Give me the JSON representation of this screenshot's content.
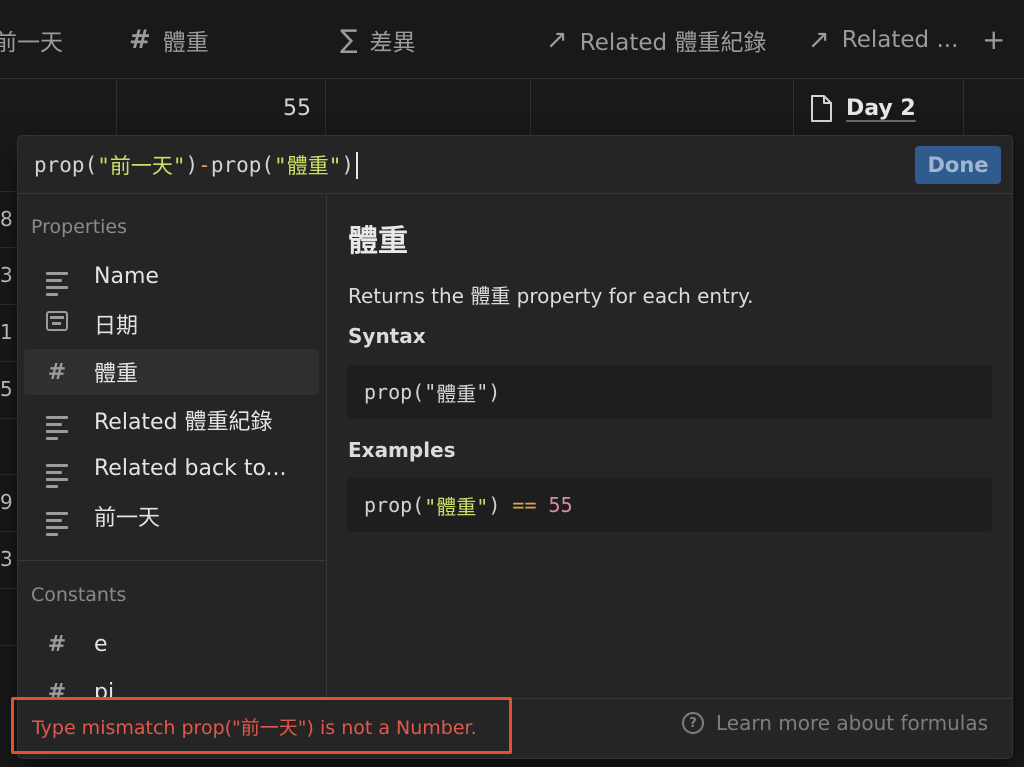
{
  "table": {
    "columns": [
      {
        "icon": "",
        "label": "前一天"
      },
      {
        "icon": "number-icon",
        "label": "體重"
      },
      {
        "icon": "sigma-icon",
        "label": "差異"
      },
      {
        "icon": "arrow-up-right-icon",
        "label": "Related 體重紀錄"
      },
      {
        "icon": "arrow-up-right-icon",
        "label": "Related ..."
      }
    ],
    "add_column": "+",
    "row": {
      "weight": "55",
      "page_title": "Day 2"
    },
    "peek_values": [
      "8",
      "3",
      "1",
      "5",
      "9",
      "3"
    ]
  },
  "editor": {
    "formula_parts": [
      "prop(",
      "\"前一天\"",
      ")",
      "-",
      "prop(",
      "\"體重\"",
      ")"
    ],
    "done_label": "Done"
  },
  "sidebar": {
    "properties_title": "Properties",
    "properties": [
      {
        "icon": "text-lines-icon",
        "label": "Name"
      },
      {
        "icon": "calendar-icon",
        "label": "日期"
      },
      {
        "icon": "number-icon",
        "label": "體重",
        "selected": true
      },
      {
        "icon": "text-lines-icon",
        "label": "Related 體重紀錄"
      },
      {
        "icon": "text-lines-icon",
        "label": "Related back to..."
      },
      {
        "icon": "text-lines-icon",
        "label": "前一天"
      }
    ],
    "constants_title": "Constants",
    "constants": [
      {
        "icon": "number-icon",
        "label": "e"
      },
      {
        "icon": "number-icon",
        "label": "pi"
      }
    ]
  },
  "detail": {
    "title": "體重",
    "desc": "Returns the 體重 property for each entry.",
    "syntax_heading": "Syntax",
    "syntax_parts": [
      "prop(\"",
      "體重",
      "\")"
    ],
    "examples_heading": "Examples",
    "example_parts": [
      "prop(",
      "\"體重\"",
      ")",
      " == ",
      "55"
    ]
  },
  "footer": {
    "error": "Type mismatch prop(\"前一天\") is not a Number.",
    "learn_more": "Learn more about formulas",
    "help_glyph": "?"
  }
}
